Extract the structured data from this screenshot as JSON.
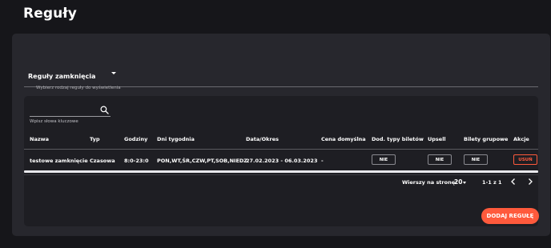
{
  "header": {
    "title": "Reguły"
  },
  "rule_select": {
    "value": "Reguły zamknięcia",
    "helper": "Wybierz rodzaj reguły do wyświetlenia"
  },
  "search": {
    "placeholder": "",
    "hint": "Wpisz słowa kluczowe",
    "icon": "search-icon"
  },
  "table": {
    "columns": [
      "Nazwa",
      "Typ",
      "Godziny",
      "Dni tygodnia",
      "Data/Okres",
      "Cena domyślna",
      "Dod. typy biletów",
      "Upsell",
      "Bilety grupowe",
      "Akcje"
    ],
    "rows": [
      {
        "name": "testowe zamknięcie",
        "type": "Czasowa",
        "hours": "8:0-23:0",
        "days": "PON,WT,ŚR,CZW,PT,SOB,NIEDZ",
        "period": "27.02.2023 - 06.03.2023",
        "price": "-",
        "extra_tickets": "NIE",
        "upsell": "NIE",
        "group_tickets": "NIE",
        "action": "USUŃ"
      }
    ]
  },
  "pagination": {
    "rows_label": "Wierszy na stronę:",
    "rows_value": "20",
    "range": "1-1 z 1"
  },
  "add_button": {
    "label": "DODAJ REGUŁĘ"
  },
  "colors": {
    "background": "#16161a",
    "panel": "#27272d",
    "card": "#1e1e23",
    "accent": "#ff5a3c"
  }
}
